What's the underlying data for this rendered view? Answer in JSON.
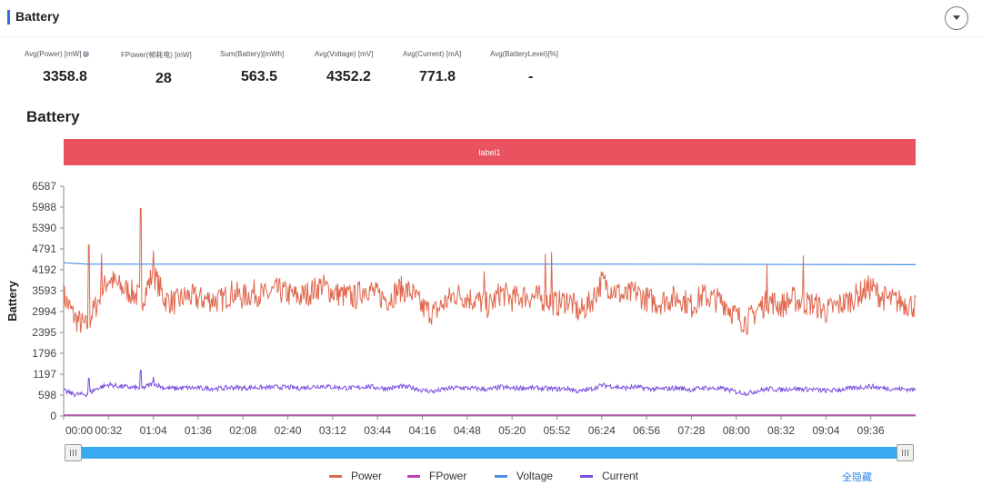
{
  "section": {
    "title": "Battery"
  },
  "stats": [
    {
      "label": "Avg(Power) [mW]",
      "value": "3358.8",
      "has_info_icon": true
    },
    {
      "label": "FPower(帧耗电) [mW]",
      "value": "28"
    },
    {
      "label": "Sum(Battery)[mWh]",
      "value": "563.5"
    },
    {
      "label": "Avg(Voltage) [mV]",
      "value": "4352.2"
    },
    {
      "label": "Avg(Current) [mA]",
      "value": "771.8"
    },
    {
      "label": "Avg(BatteryLevel)[%]",
      "value": "-"
    }
  ],
  "chart_title": "Battery",
  "label_band": "label1",
  "legend": {
    "hide_all": "全隐藏"
  },
  "chart_data": {
    "type": "line",
    "title": "Battery",
    "ylabel": "Battery",
    "xlabel": "",
    "ylim": [
      0,
      6587
    ],
    "y_ticks": [
      0,
      598,
      1197,
      1796,
      2395,
      2994,
      3593,
      4192,
      4791,
      5390,
      5988,
      6587
    ],
    "x_ticks": [
      "00:00",
      "00:32",
      "01:04",
      "01:36",
      "02:08",
      "02:40",
      "03:12",
      "03:44",
      "04:16",
      "04:48",
      "05:20",
      "05:52",
      "06:24",
      "06:56",
      "07:28",
      "08:00",
      "08:32",
      "09:04",
      "09:36"
    ],
    "x_range_seconds": [
      0,
      608
    ],
    "grid": false,
    "legend_position": "bottom",
    "annotations": [
      "label1"
    ],
    "series": [
      {
        "name": "Power",
        "color": "#e0684f",
        "x": [
          0,
          8,
          16,
          24,
          32,
          40,
          48,
          56,
          64,
          72,
          80,
          88,
          96,
          104,
          112,
          120,
          128,
          136,
          144,
          152,
          160,
          168,
          176,
          184,
          192,
          200,
          208,
          216,
          224,
          232,
          240,
          248,
          256,
          264,
          272,
          280,
          288,
          296,
          304,
          312,
          320,
          328,
          336,
          344,
          352,
          360,
          368,
          376,
          384,
          392,
          400,
          408,
          416,
          424,
          432,
          440,
          448,
          456,
          464,
          472,
          480,
          488,
          496,
          504,
          512,
          520,
          528,
          536,
          544,
          552,
          560,
          568,
          576,
          584,
          592,
          600,
          608
        ],
        "values": [
          3450,
          2800,
          2550,
          3250,
          3950,
          3700,
          3550,
          3350,
          4100,
          3350,
          3250,
          3450,
          3350,
          3350,
          3300,
          3550,
          3400,
          3550,
          3450,
          3600,
          3500,
          3400,
          3550,
          3750,
          3550,
          3450,
          3400,
          3700,
          3450,
          3350,
          3650,
          3550,
          3100,
          2950,
          3250,
          3500,
          3400,
          3300,
          3150,
          3550,
          3350,
          3450,
          3400,
          3350,
          3200,
          3350,
          2950,
          3250,
          3850,
          3650,
          3400,
          3550,
          3350,
          3250,
          3350,
          3400,
          3150,
          3450,
          3350,
          3250,
          2850,
          2700,
          3100,
          3300,
          3150,
          3350,
          3250,
          3200,
          3000,
          3150,
          3300,
          3500,
          3700,
          3400,
          3300,
          3250,
          3150
        ],
        "peaks": [
          [
            18,
            4900
          ],
          [
            27,
            4650
          ],
          [
            55,
            5950
          ],
          [
            64,
            4750
          ],
          [
            300,
            4150
          ],
          [
            344,
            4650
          ],
          [
            348,
            4700
          ],
          [
            502,
            4350
          ],
          [
            528,
            4600
          ]
        ]
      },
      {
        "name": "FPower",
        "color": "#c040b8",
        "x": [
          0,
          608
        ],
        "values": [
          28,
          28
        ]
      },
      {
        "name": "Voltage",
        "color": "#4a90e2",
        "x": [
          0,
          16,
          200,
          400,
          608
        ],
        "values": [
          4392,
          4352,
          4352,
          4352,
          4338
        ]
      },
      {
        "name": "Current",
        "color": "#7b4fe0",
        "x": [
          0,
          8,
          16,
          24,
          32,
          40,
          48,
          56,
          64,
          72,
          80,
          88,
          96,
          104,
          112,
          120,
          128,
          136,
          144,
          152,
          160,
          168,
          176,
          184,
          192,
          200,
          208,
          216,
          224,
          232,
          240,
          248,
          256,
          264,
          272,
          280,
          288,
          296,
          304,
          312,
          320,
          328,
          336,
          344,
          352,
          360,
          368,
          376,
          384,
          392,
          400,
          408,
          416,
          424,
          432,
          440,
          448,
          456,
          464,
          472,
          480,
          488,
          496,
          504,
          512,
          520,
          528,
          536,
          544,
          552,
          560,
          568,
          576,
          584,
          592,
          600,
          608
        ],
        "values": [
          720,
          620,
          620,
          790,
          900,
          850,
          820,
          790,
          940,
          800,
          790,
          810,
          800,
          790,
          790,
          820,
          800,
          820,
          810,
          830,
          820,
          800,
          830,
          860,
          830,
          810,
          800,
          850,
          810,
          790,
          840,
          820,
          740,
          700,
          770,
          810,
          800,
          780,
          760,
          830,
          790,
          810,
          800,
          790,
          770,
          790,
          700,
          770,
          880,
          850,
          800,
          830,
          790,
          770,
          790,
          800,
          750,
          810,
          790,
          770,
          690,
          650,
          730,
          780,
          750,
          790,
          770,
          760,
          720,
          750,
          780,
          820,
          850,
          800,
          780,
          770,
          750
        ],
        "peaks": [
          [
            18,
            1080
          ],
          [
            55,
            1310
          ],
          [
            64,
            1120
          ]
        ]
      }
    ]
  }
}
